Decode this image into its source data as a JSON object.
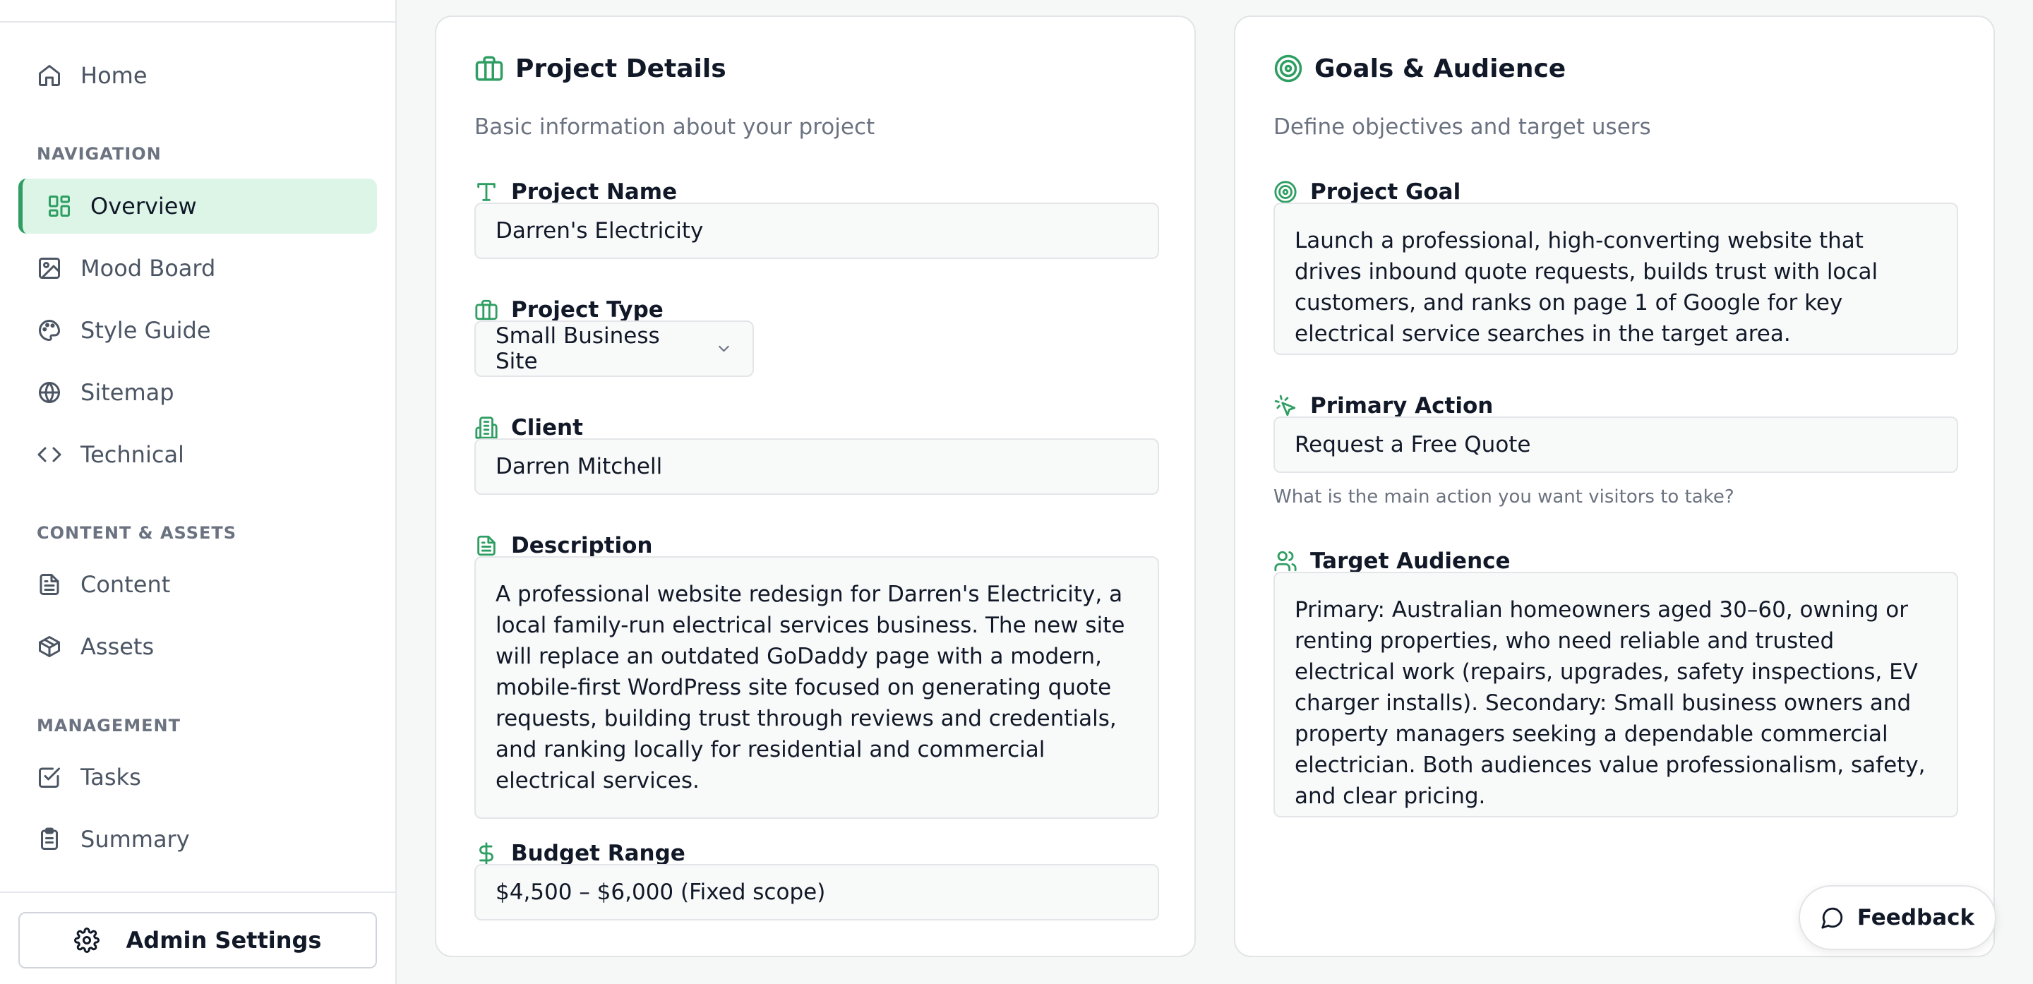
{
  "sidebar": {
    "home": "Home",
    "sections": {
      "navigation": "NAVIGATION",
      "content_assets": "CONTENT & ASSETS",
      "management": "MANAGEMENT"
    },
    "items": {
      "overview": "Overview",
      "mood_board": "Mood Board",
      "style_guide": "Style Guide",
      "sitemap": "Sitemap",
      "technical": "Technical",
      "content": "Content",
      "assets": "Assets",
      "tasks": "Tasks",
      "summary": "Summary"
    },
    "active_item": "Overview",
    "admin_settings": "Admin Settings"
  },
  "project_details": {
    "title": "Project Details",
    "subtitle": "Basic information about your project",
    "project_name": {
      "label": "Project Name",
      "value": "Darren's Electricity"
    },
    "project_type": {
      "label": "Project Type",
      "value": "Small Business Site"
    },
    "client": {
      "label": "Client",
      "value": "Darren Mitchell"
    },
    "description": {
      "label": "Description",
      "value": "A professional website redesign for Darren's Electricity, a local family-run electrical services business. The new site will replace an outdated GoDaddy page with a modern, mobile-first WordPress site focused on generating quote requests, building trust through reviews and credentials, and ranking locally for residential and commercial electrical services."
    },
    "budget": {
      "label": "Budget Range",
      "value": "$4,500 – $6,000 (Fixed scope)"
    }
  },
  "goals_audience": {
    "title": "Goals & Audience",
    "subtitle": "Define objectives and target users",
    "project_goal": {
      "label": "Project Goal",
      "value": "Launch a professional, high-converting website that drives inbound quote requests, builds trust with local customers, and ranks on page 1 of Google for key electrical service searches in the target area."
    },
    "primary_action": {
      "label": "Primary Action",
      "value": "Request a Free Quote",
      "hint": "What is the main action you want visitors to take?"
    },
    "target_audience": {
      "label": "Target Audience",
      "value": "Primary: Australian homeowners aged 30–60, owning or renting properties, who need reliable and trusted electrical work (repairs, upgrades, safety inspections, EV charger installs). Secondary: Small business owners and property managers seeking a dependable commercial electrician. Both audiences value professionalism, safety, and clear pricing."
    }
  },
  "feedback_label": "Feedback",
  "colors": {
    "accent": "#2f9e63",
    "active_bg": "#dcf5e7"
  }
}
